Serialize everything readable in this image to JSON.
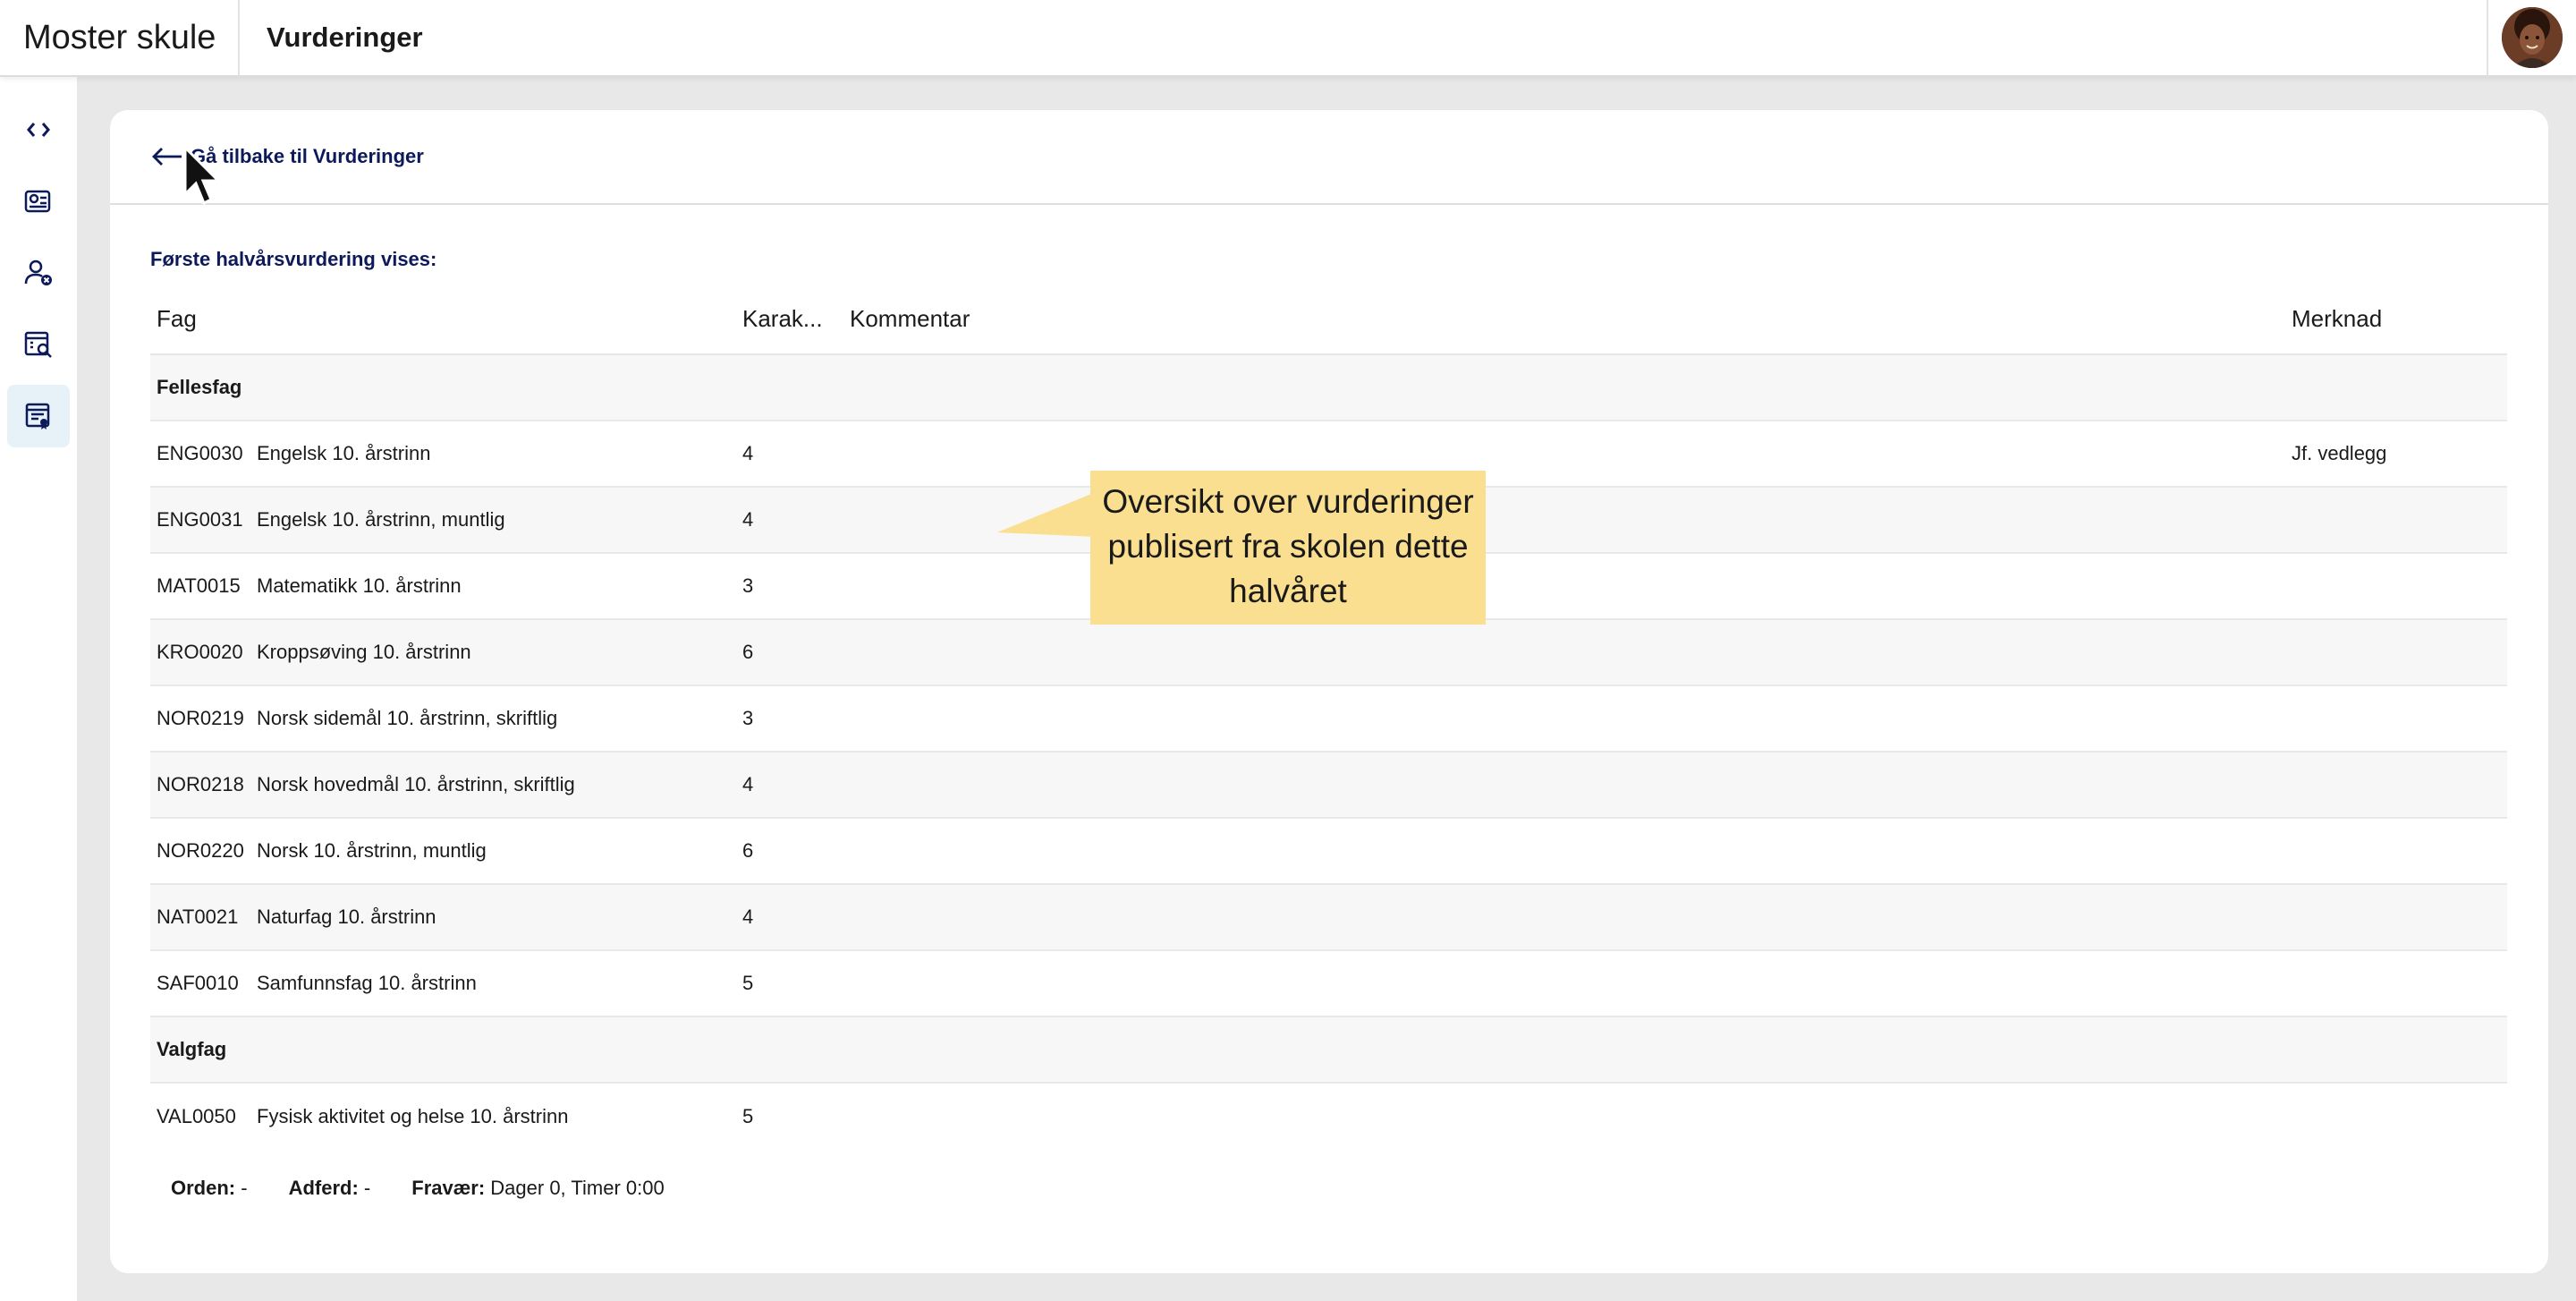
{
  "app": {
    "title": "Moster skule",
    "page_title": "Vurderinger"
  },
  "sidebar": {
    "items": [
      {
        "icon": "collapse-icon"
      },
      {
        "icon": "dashboard-icon"
      },
      {
        "icon": "person-absence-icon"
      },
      {
        "icon": "search-list-icon"
      },
      {
        "icon": "assessment-icon",
        "active": true
      }
    ]
  },
  "back": {
    "label": "Gå tilbake til Vurderinger"
  },
  "section": {
    "label": "Første halvårsvurdering vises:"
  },
  "table": {
    "headers": {
      "fag": "Fag",
      "karakter": "Karak...",
      "kommentar": "Kommentar",
      "merknad": "Merknad"
    },
    "groups": [
      {
        "name": "Fellesfag",
        "rows": [
          {
            "code": "ENG0030",
            "name": "Engelsk 10. årstrinn",
            "grade": "4",
            "comment": "",
            "note": "Jf. vedlegg"
          },
          {
            "code": "ENG0031",
            "name": "Engelsk 10. årstrinn, muntlig",
            "grade": "4",
            "comment": "",
            "note": ""
          },
          {
            "code": "MAT0015",
            "name": "Matematikk 10. årstrinn",
            "grade": "3",
            "comment": "",
            "note": ""
          },
          {
            "code": "KRO0020",
            "name": "Kroppsøving 10. årstrinn",
            "grade": "6",
            "comment": "",
            "note": ""
          },
          {
            "code": "NOR0219",
            "name": "Norsk sidemål 10. årstrinn, skriftlig",
            "grade": "3",
            "comment": "",
            "note": ""
          },
          {
            "code": "NOR0218",
            "name": "Norsk hovedmål 10. årstrinn, skriftlig",
            "grade": "4",
            "comment": "",
            "note": ""
          },
          {
            "code": "NOR0220",
            "name": "Norsk 10. årstrinn, muntlig",
            "grade": "6",
            "comment": "",
            "note": ""
          },
          {
            "code": "NAT0021",
            "name": "Naturfag 10. årstrinn",
            "grade": "4",
            "comment": "",
            "note": ""
          },
          {
            "code": "SAF0010",
            "name": "Samfunnsfag 10. årstrinn",
            "grade": "5",
            "comment": "",
            "note": ""
          }
        ]
      },
      {
        "name": "Valgfag",
        "rows": [
          {
            "code": "VAL0050",
            "name": "Fysisk aktivitet og helse 10. årstrinn",
            "grade": "5",
            "comment": "",
            "note": ""
          }
        ]
      }
    ]
  },
  "footer": {
    "orden_label": "Orden:",
    "orden_value": " -",
    "adferd_label": "Adferd:",
    "adferd_value": " -",
    "fravaer_label": "Fravær:",
    "fravaer_value": " Dager 0, Timer 0:00"
  },
  "tooltip": {
    "text": "Oversikt over vurderinger publisert fra skolen dette halvåret",
    "color": "#fadf90"
  }
}
